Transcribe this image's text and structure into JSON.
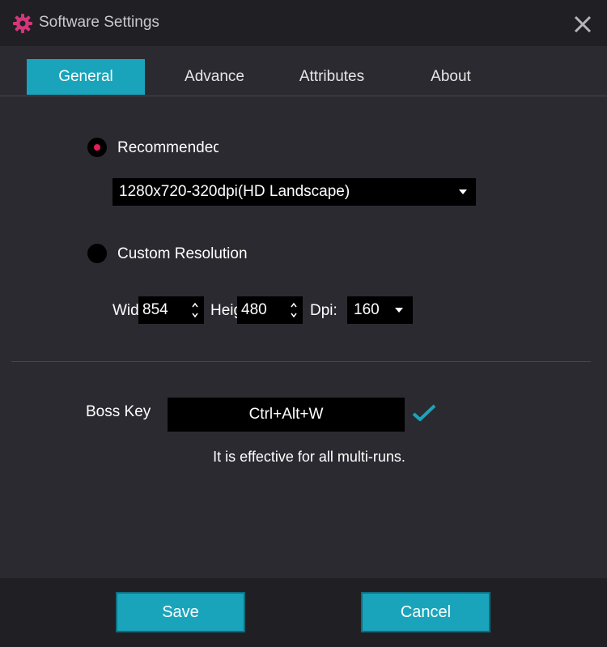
{
  "window": {
    "title": "Software Settings",
    "icon": "gear-icon",
    "close_icon": "close-icon"
  },
  "tabs": [
    {
      "label": "General",
      "active": true
    },
    {
      "label": "Advance",
      "active": false
    },
    {
      "label": "Attributes",
      "active": false
    },
    {
      "label": "About",
      "active": false
    }
  ],
  "resolution": {
    "recommended": {
      "label": "Recommended",
      "selected": true,
      "dropdown_value": "1280x720-320dpi(HD Landscape)"
    },
    "custom": {
      "label": "Custom Resolution",
      "selected": false,
      "width_label": "Width",
      "width_value": "854",
      "height_label": "Height",
      "height_value": "480",
      "dpi_label": "Dpi:",
      "dpi_value": "160"
    }
  },
  "boss_key": {
    "label": "Boss Key",
    "value": "Ctrl+Alt+W",
    "note": "It is effective for all multi-runs."
  },
  "footer": {
    "save_label": "Save",
    "cancel_label": "Cancel"
  },
  "colors": {
    "accent": "#1aa4bb",
    "radio_selected": "#e21e5c",
    "background": "#2b2a30",
    "titlebar": "#202024"
  }
}
